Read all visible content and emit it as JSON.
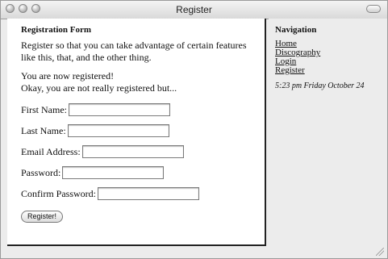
{
  "window": {
    "title": "Register"
  },
  "main": {
    "heading": "Registration Form",
    "intro": "Register so that you can take advantage of certain features like this, that, and the other thing.",
    "status_line1": "You are now registered!",
    "status_line2": "Okay, you are not really registered but...",
    "fields": [
      {
        "label": "First Name:",
        "value": ""
      },
      {
        "label": "Last Name:",
        "value": ""
      },
      {
        "label": "Email Address:",
        "value": ""
      },
      {
        "label": "Password:",
        "value": ""
      },
      {
        "label": "Confirm Password:",
        "value": ""
      }
    ],
    "submit_label": "Register!"
  },
  "sidebar": {
    "heading": "Navigation",
    "links": [
      "Home",
      "Discography",
      "Login",
      "Register"
    ],
    "timestamp": "5:23 pm Friday October 24"
  }
}
